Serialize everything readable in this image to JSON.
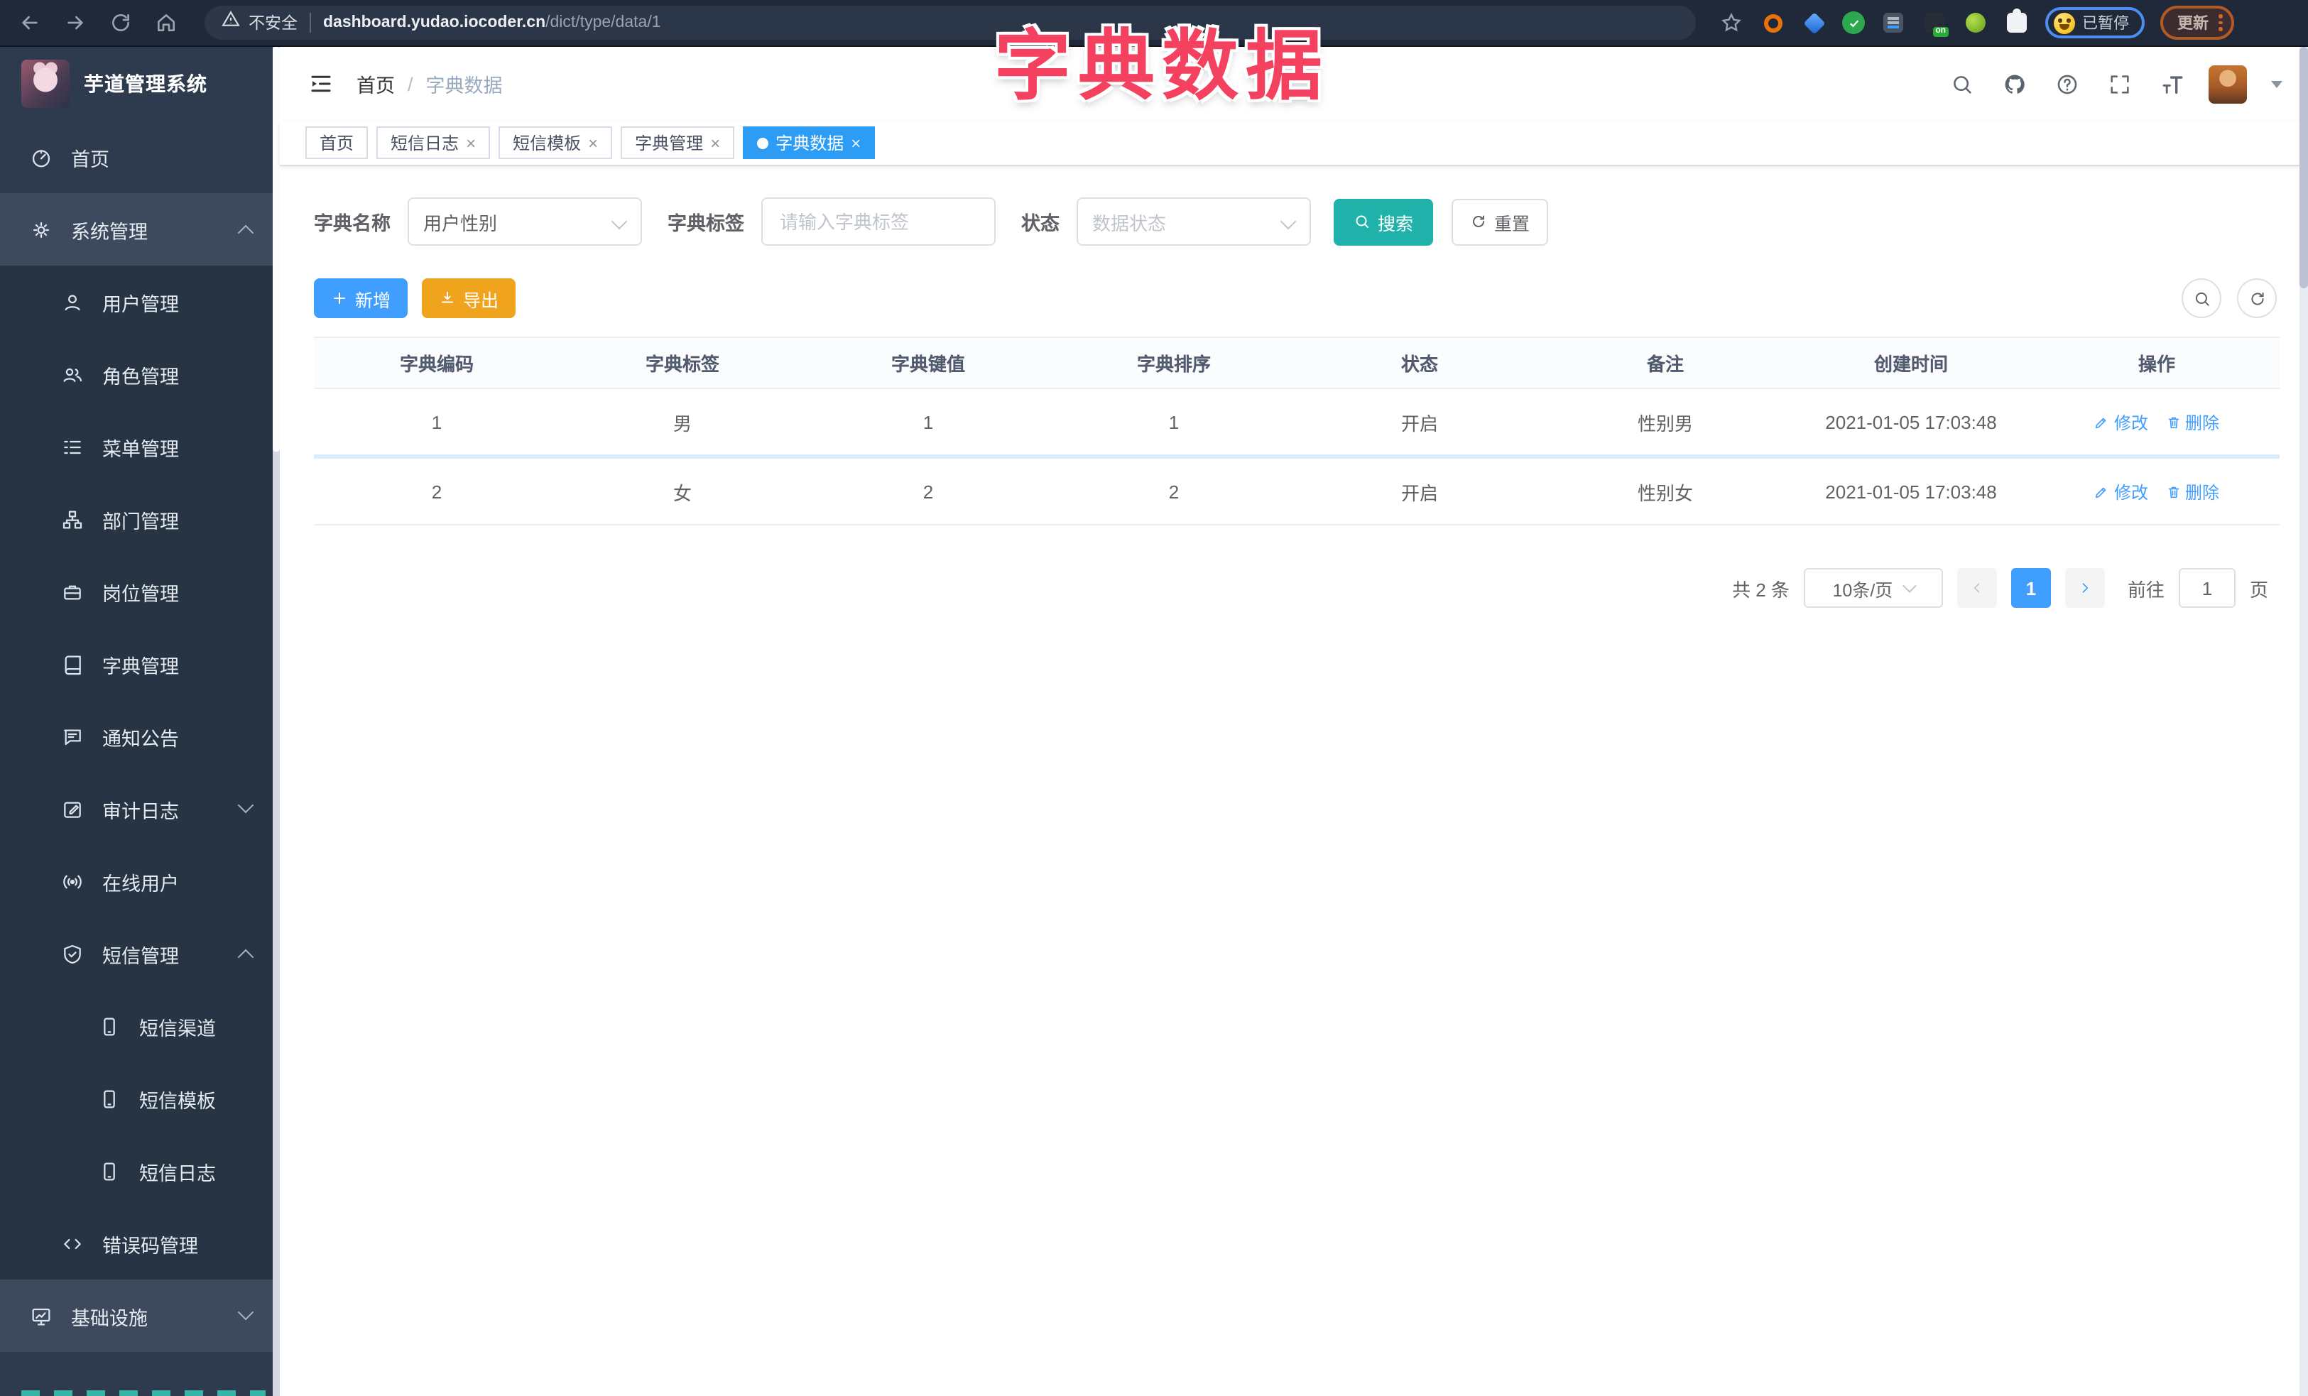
{
  "browser": {
    "security_label": "不安全",
    "url_domain": "dashboard.yudao.iocoder.cn",
    "url_path": "/dict/type/data/1",
    "ext_on_badge": "on",
    "paused_label": "已暂停",
    "update_label": "更新"
  },
  "overlay_title": "字典数据",
  "sidebar": {
    "logo_title": "芋道管理系统",
    "items": [
      {
        "label": "首页"
      },
      {
        "label": "系统管理"
      },
      {
        "label": "用户管理"
      },
      {
        "label": "角色管理"
      },
      {
        "label": "菜单管理"
      },
      {
        "label": "部门管理"
      },
      {
        "label": "岗位管理"
      },
      {
        "label": "字典管理"
      },
      {
        "label": "通知公告"
      },
      {
        "label": "审计日志"
      },
      {
        "label": "在线用户"
      },
      {
        "label": "短信管理"
      },
      {
        "label": "短信渠道"
      },
      {
        "label": "短信模板"
      },
      {
        "label": "短信日志"
      },
      {
        "label": "错误码管理"
      },
      {
        "label": "基础设施"
      }
    ]
  },
  "header": {
    "breadcrumb_home": "首页",
    "breadcrumb_sep": "/",
    "breadcrumb_current": "字典数据"
  },
  "tags": [
    {
      "label": "首页"
    },
    {
      "label": "短信日志"
    },
    {
      "label": "短信模板"
    },
    {
      "label": "字典管理"
    },
    {
      "label": "字典数据"
    }
  ],
  "filters": {
    "name_label": "字典名称",
    "name_value": "用户性别",
    "tag_label": "字典标签",
    "tag_placeholder": "请输入字典标签",
    "status_label": "状态",
    "status_placeholder": "数据状态",
    "search_label": "搜索",
    "reset_label": "重置"
  },
  "toolbar": {
    "add_label": "新增",
    "export_label": "导出"
  },
  "table": {
    "columns": [
      "字典编码",
      "字典标签",
      "字典键值",
      "字典排序",
      "状态",
      "备注",
      "创建时间",
      "操作"
    ],
    "rows": [
      {
        "code": "1",
        "label": "男",
        "value": "1",
        "sort": "1",
        "status": "开启",
        "remark": "性别男",
        "created": "2021-01-05 17:03:48"
      },
      {
        "code": "2",
        "label": "女",
        "value": "2",
        "sort": "2",
        "status": "开启",
        "remark": "性别女",
        "created": "2021-01-05 17:03:48"
      }
    ],
    "edit_label": "修改",
    "delete_label": "删除"
  },
  "pagination": {
    "total": "共 2 条",
    "page_size": "10条/页",
    "page": "1",
    "goto_label": "前往",
    "goto_value": "1",
    "unit_label": "页"
  },
  "colors": {
    "accent_blue": "#409eff",
    "active_tag_blue": "#2d9cf4",
    "search_teal": "#20b2aa",
    "export_orange": "#f0a31c",
    "title_pink": "#f4415f",
    "sidebar_bg": "#2e3b4e"
  }
}
